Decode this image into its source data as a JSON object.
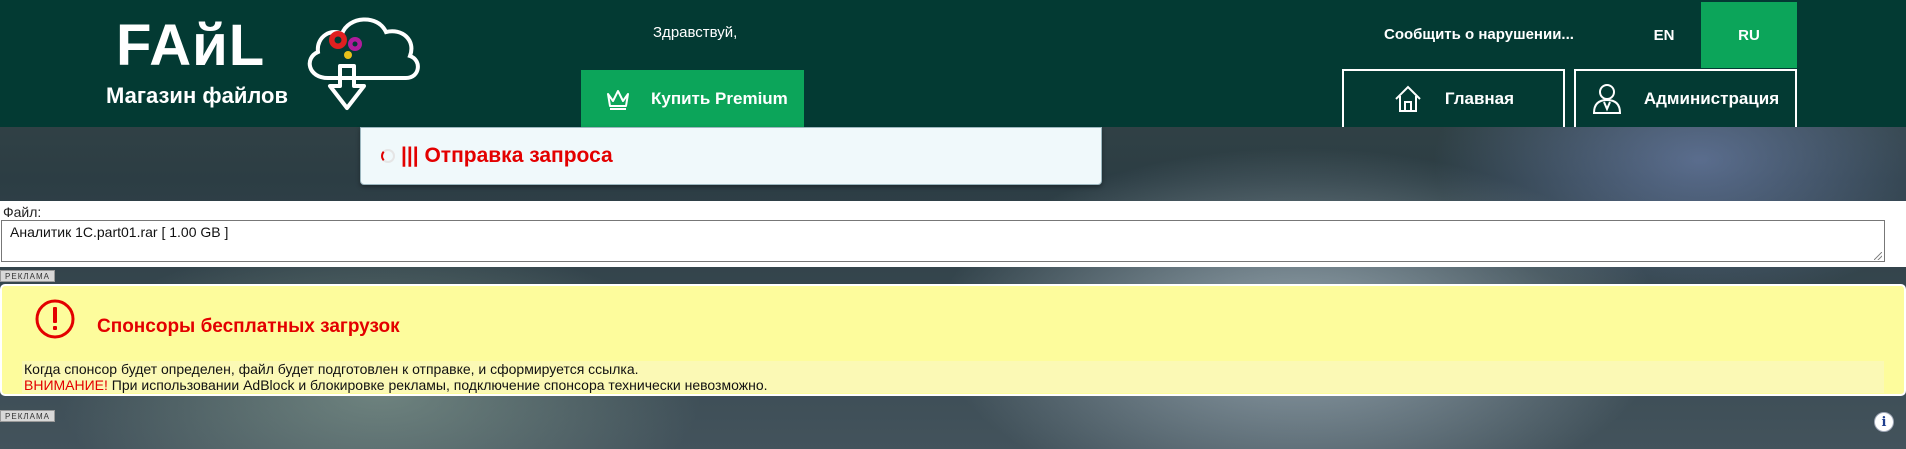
{
  "header": {
    "logo_title": "FAйL",
    "logo_subtitle": "Магазин файлов",
    "greeting": "Здравствуй,",
    "premium_label": "Купить Premium",
    "report_label": "Сообщить о нарушении...",
    "languages": [
      "EN",
      "RU"
    ],
    "active_language": "RU",
    "nav": {
      "home_label": "Главная",
      "admin_label": "Администрация"
    }
  },
  "status": {
    "loading_text": "||| Отправка запроса"
  },
  "file": {
    "label": "Файл:",
    "value": "Аналитик 1С.part01.rar [ 1.00 GB ]"
  },
  "ad_tag": "РЕКЛАМА",
  "sponsor": {
    "title": "Спонсоры бесплатных загрузок",
    "line1": "Когда спонсор будет определен, файл будет подготовлен к отправке, и сформируется ссылка.",
    "warning_word": "ВНИМАНИЕ!",
    "line2": " При использовании AdBlock и блокировке рекламы, подключение спонсора технически невозможно."
  },
  "info_button": "i",
  "colors": {
    "header_bg": "#033a33",
    "accent_green": "#0ca55a",
    "alert_red": "#e30000",
    "sponsor_bg": "#fdfc9c"
  },
  "icons": [
    "cloud-gears-icon",
    "crown-icon",
    "home-icon",
    "admin-user-icon",
    "spinner-icon",
    "warning-icon",
    "info-icon"
  ]
}
